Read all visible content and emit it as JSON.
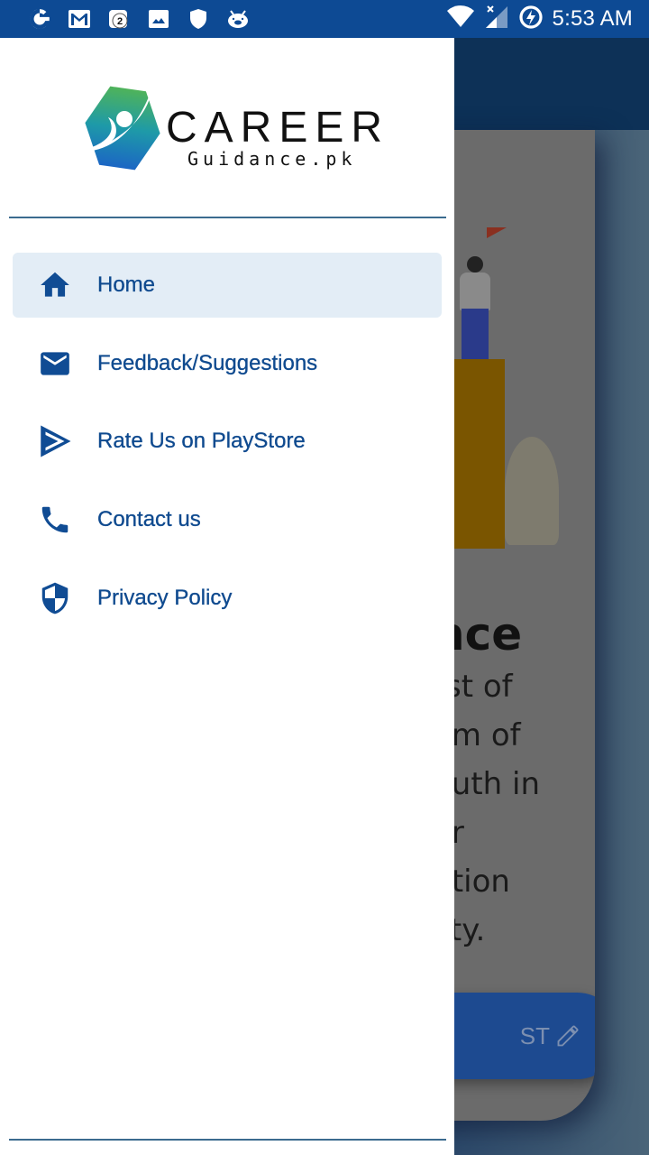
{
  "status_bar": {
    "time": "5:53 AM",
    "notification_icons": [
      "google-icon",
      "gmail-icon",
      "badge-app-icon",
      "gallery-icon",
      "shield-icon",
      "pig-app-icon"
    ],
    "badge_count": "2",
    "system_icons": [
      "wifi-icon",
      "no-signal-icon",
      "battery-charging-icon"
    ]
  },
  "drawer": {
    "logo": {
      "title": "CAREER",
      "subtitle": "Guidance.pk"
    },
    "menu": [
      {
        "label": "Home",
        "icon": "home-icon",
        "active": true
      },
      {
        "label": "Feedback/Suggestions",
        "icon": "mail-icon",
        "active": false
      },
      {
        "label": "Rate Us on PlayStore",
        "icon": "playstore-icon",
        "active": false
      },
      {
        "label": "Contact us",
        "icon": "phone-icon",
        "active": false
      },
      {
        "label": "Privacy Policy",
        "icon": "shield-icon",
        "active": false
      }
    ]
  },
  "background": {
    "heading_fragment": "nce",
    "body_fragment": "rst of\nem of\nouth in\ner\nation\nlity.",
    "cta_fragment": "ST"
  },
  "colors": {
    "status_bar": "#0d4a94",
    "accent": "#104c94",
    "active_item_bg": "#e3edf6",
    "divider": "#3b6b8f"
  }
}
